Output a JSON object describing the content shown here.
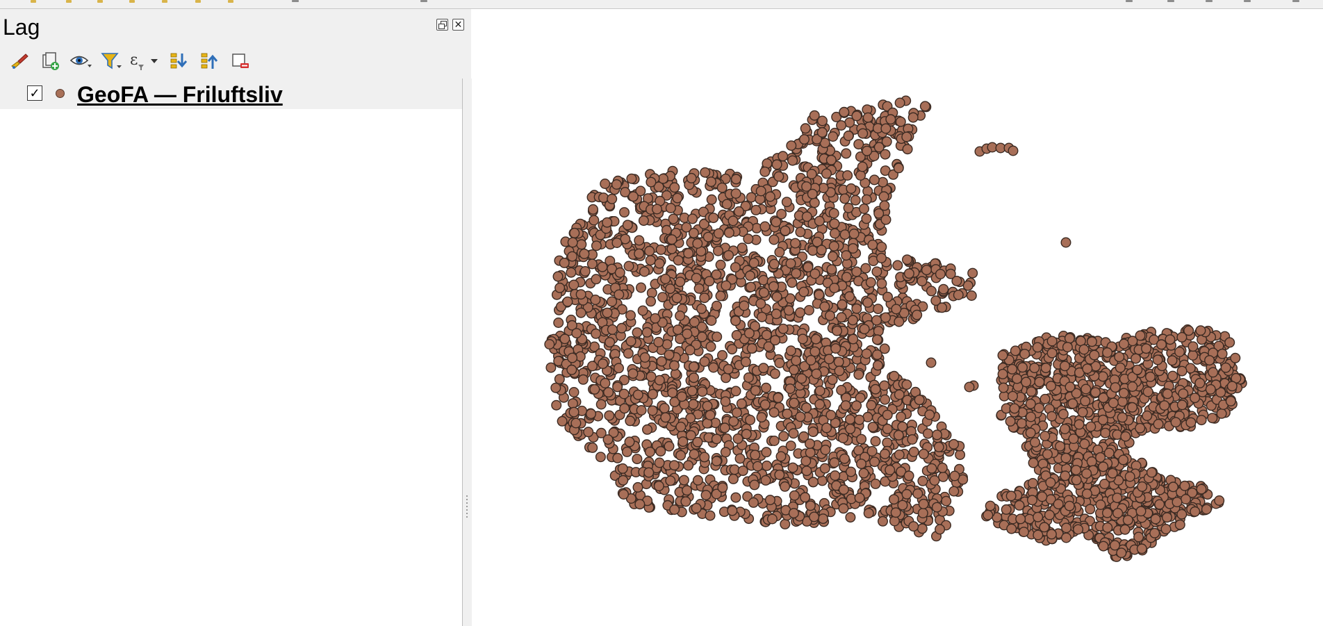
{
  "panel": {
    "title": "Lag",
    "toolbar": [
      {
        "icon": "style-brush-icon"
      },
      {
        "icon": "add-group-icon"
      },
      {
        "icon": "manage-visibility-icon"
      },
      {
        "icon": "filter-legend-icon"
      },
      {
        "icon": "filter-expression-icon"
      },
      {
        "icon": "expand-all-icon"
      },
      {
        "icon": "collapse-all-icon"
      },
      {
        "icon": "remove-layer-icon"
      }
    ]
  },
  "layers": [
    {
      "name": "GeoFA — Friluftsliv",
      "checked": true,
      "checkmark": "✓",
      "symbol_color": "#a86f58"
    }
  ],
  "map": {
    "point_fill": "#a86f58",
    "point_stroke": "#3b2a22",
    "background": "#ffffff"
  },
  "colors": {
    "panel_bg": "#f0f0f0",
    "accent_blue": "#2f6fb8",
    "filter_yellow": "#e7b416"
  }
}
